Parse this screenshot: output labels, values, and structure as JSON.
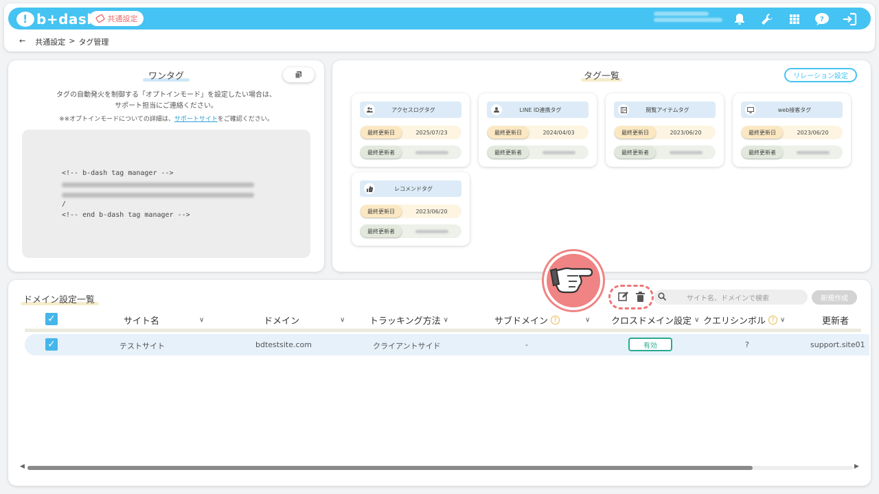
{
  "header": {
    "logo_text": "b+dash",
    "common_settings_label": "共通設定",
    "icons": [
      "bell-icon",
      "wrench-icon",
      "grid-icon",
      "help-bubble-icon",
      "logout-icon"
    ]
  },
  "breadcrumb": {
    "back": "←",
    "parent": "共通設定",
    "separator": ">",
    "current": "タグ管理"
  },
  "onetag": {
    "title": "ワンタグ",
    "desc_line1": "タグの自動発火を制御する「オプトインモード」を設定したい場合は、",
    "desc_line2": "サポート担当にご連絡ください。",
    "note_prefix": "※※オプトインモードについての詳細は、",
    "note_link": "サポートサイト",
    "note_suffix": "をご確認ください。",
    "code_start": "<!-- b-dash tag manager -->",
    "code_end": "<!-- end b-dash tag manager -->",
    "code_mid": "/"
  },
  "tag_list": {
    "title": "タグ一覧",
    "relation_button": "リレーション設定",
    "date_label": "最終更新日",
    "user_label": "最終更新者",
    "cards": [
      {
        "name": "アクセスログタグ",
        "date": "2025/07/23",
        "icon": "users-icon"
      },
      {
        "name": "LINE ID連携タグ",
        "date": "2024/04/03",
        "icon": "person-icon"
      },
      {
        "name": "閲覧アイテムタグ",
        "date": "2023/06/20",
        "icon": "catalog-icon"
      },
      {
        "name": "web接客タグ",
        "date": "2023/06/20",
        "icon": "monitor-icon"
      },
      {
        "name": "レコメンドタグ",
        "date": "2023/06/20",
        "icon": "thumbs-up-icon"
      }
    ]
  },
  "domain": {
    "title": "ドメイン設定一覧",
    "search_placeholder": "サイト名、ドメインで検索",
    "new_button": "新規作成",
    "columns": {
      "site_name": "サイト名",
      "domain": "ドメイン",
      "tracking": "トラッキング方法",
      "subdomain": "サブドメイン",
      "cross_domain": "クロスドメイン設定",
      "query_symbol": "クエリシンボル",
      "updater": "更新者"
    },
    "rows": [
      {
        "site_name": "テストサイト",
        "domain": "bdtestsite.com",
        "tracking": "クライアントサイド",
        "subdomain": "-",
        "cross_domain": "有効",
        "query_symbol": "?",
        "updater": "support.site01"
      }
    ]
  },
  "colors": {
    "brand": "#45c3f2",
    "accent_red": "#ef7575",
    "status_green": "#28a98e"
  }
}
